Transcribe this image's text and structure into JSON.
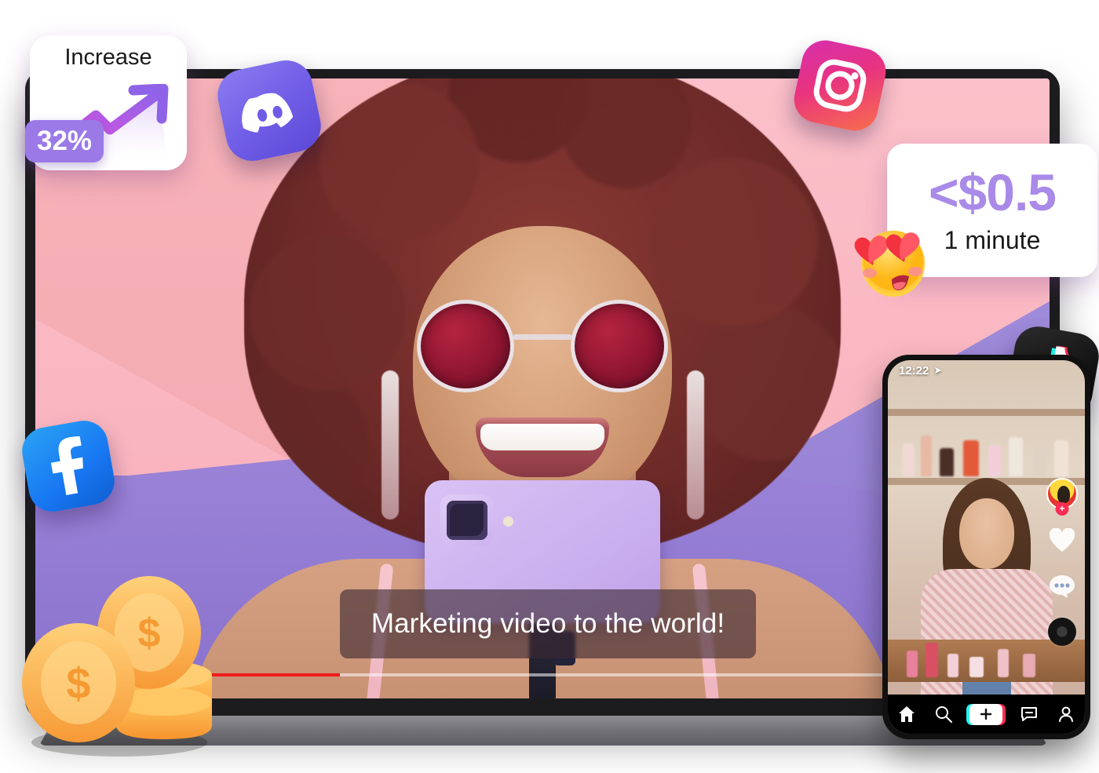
{
  "increase_card": {
    "title": "Increase",
    "badge": "32%",
    "chart_icon": "upward-trend-arrow"
  },
  "price_card": {
    "price": "<$0.5",
    "duration": "1 minute",
    "emoji": "heart-eyes-emoji"
  },
  "video": {
    "caption": "Marketing video to the world!",
    "progress_percent": 30
  },
  "social_icons": [
    {
      "name": "discord-icon",
      "label": "Discord"
    },
    {
      "name": "instagram-icon",
      "label": "Instagram"
    },
    {
      "name": "facebook-icon",
      "label": "Facebook"
    },
    {
      "name": "tiktok-icon",
      "label": "TikTok"
    }
  ],
  "decor": {
    "coins": "gold-coins-icon"
  },
  "phone": {
    "status": {
      "time": "12:22",
      "location_icon": "location-arrow-icon"
    },
    "side_actions": [
      {
        "name": "avatar",
        "badge": "+"
      },
      {
        "name": "like-heart-icon"
      },
      {
        "name": "comment-bubble-icon"
      },
      {
        "name": "music-disc-icon"
      }
    ],
    "bottom_nav": [
      {
        "name": "home-icon",
        "label": "Home"
      },
      {
        "name": "search-icon",
        "label": "Discover"
      },
      {
        "name": "create-icon",
        "label": "Create"
      },
      {
        "name": "inbox-icon",
        "label": "Inbox"
      },
      {
        "name": "profile-icon",
        "label": "Profile"
      }
    ]
  },
  "colors": {
    "purple_accent": "#a98ae8",
    "badge_purple": "#9b7ae8",
    "progress_red": "#ef1c1c",
    "tiktok_pink": "#fe2c55",
    "tiktok_cyan": "#25f4ee"
  }
}
